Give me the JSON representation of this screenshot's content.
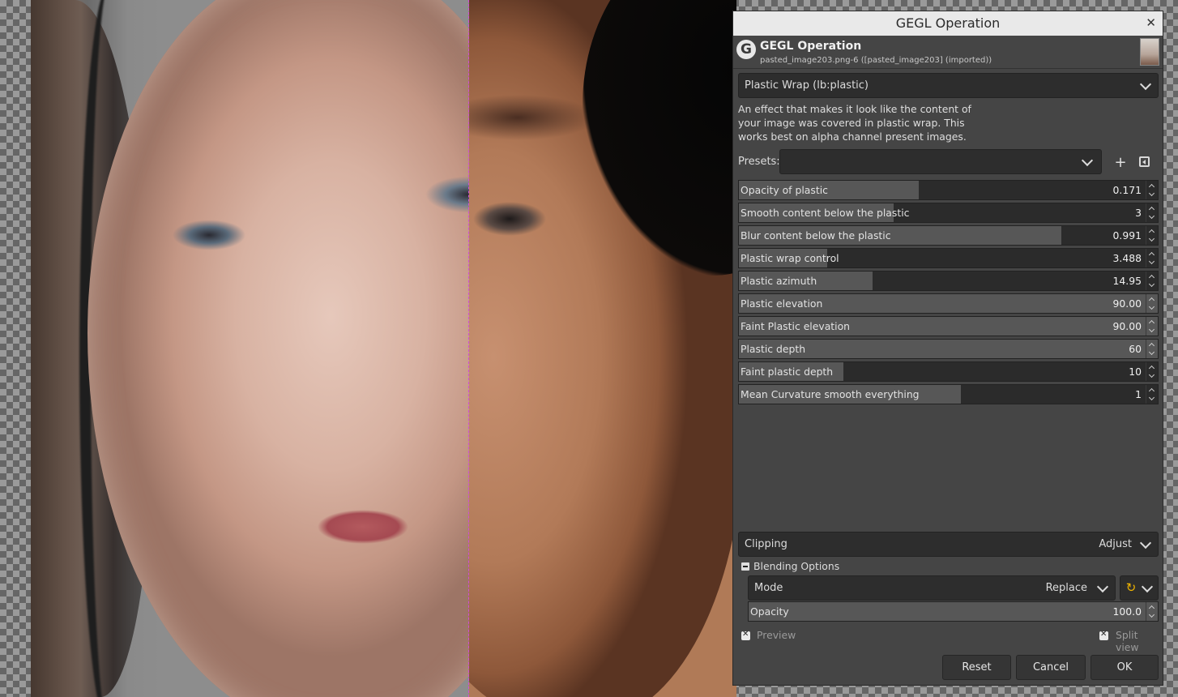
{
  "dialog": {
    "window_title": "GEGL Operation",
    "close_glyph": "✕",
    "header_title": "GEGL Operation",
    "header_subtitle": "pasted_image203.png-6 ([pasted_image203] (imported))",
    "operation": "Plastic Wrap (lb:plastic)",
    "description": "An effect that makes it look like the content of your image was covered in plastic wrap. This works best on alpha channel present images.",
    "presets_label": "Presets:",
    "presets_value": "",
    "add_preset_glyph": "+",
    "params": [
      {
        "label": "Opacity of plastic",
        "value": "0.171",
        "fill": 0.43
      },
      {
        "label": "Smooth content below the plastic",
        "value": "3",
        "fill": 0.37
      },
      {
        "label": "Blur content below the plastic",
        "value": "0.991",
        "fill": 0.77
      },
      {
        "label": "Plastic wrap control",
        "value": "3.488",
        "fill": 0.21
      },
      {
        "label": "Plastic azimuth",
        "value": "14.95",
        "fill": 0.32
      },
      {
        "label": "Plastic elevation",
        "value": "90.00",
        "fill": 1.0
      },
      {
        "label": "Faint Plastic elevation",
        "value": "90.00",
        "fill": 1.0
      },
      {
        "label": "Plastic depth",
        "value": "60",
        "fill": 1.0
      },
      {
        "label": "Faint plastic depth",
        "value": "10",
        "fill": 0.25
      },
      {
        "label": "Mean Curvature smooth everything",
        "value": "1",
        "fill": 0.53
      }
    ],
    "clipping_label": "Clipping",
    "clipping_value": "Adjust",
    "blending_label": "Blending Options",
    "mode_label": "Mode",
    "mode_value": "Replace",
    "opacity_label": "Opacity",
    "opacity_value": "100.0",
    "opacity_fill": 1.0,
    "preview_label": "Preview",
    "split_view_label": "Split view",
    "buttons": {
      "reset": "Reset",
      "cancel": "Cancel",
      "ok": "OK"
    }
  },
  "icons": {
    "logo": "gegl-logo-icon",
    "mode_switch": "reset-mode-icon"
  }
}
